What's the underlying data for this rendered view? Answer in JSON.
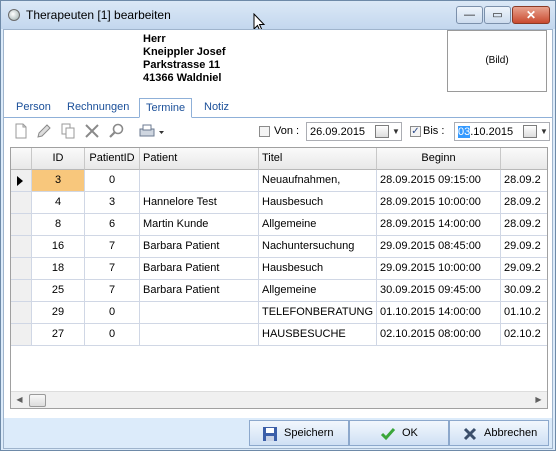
{
  "window": {
    "title": "Therapeuten [1] bearbeiten",
    "minimize_glyph": "—",
    "maximize_glyph": "▭",
    "close_glyph": "✕"
  },
  "address": {
    "salutation": "Herr",
    "name": "Kneippler Josef",
    "street": "Parkstrasse 11",
    "city": "41366 Waldniel"
  },
  "picture": {
    "label": "(Bild)"
  },
  "tabs": [
    {
      "label": "Person"
    },
    {
      "label": "Rechnungen"
    },
    {
      "label": "Termine",
      "active": true
    },
    {
      "label": "Notiz"
    }
  ],
  "toolbar": {
    "icons": [
      "new-document-icon",
      "edit-pencil-icon",
      "copy-icon",
      "delete-x-icon",
      "search-magnifier-icon",
      "print-icon"
    ],
    "from_label": "Von :",
    "from_checked": false,
    "from_date": "26.09.2015",
    "to_label": "Bis :",
    "to_checked": true,
    "to_date_selected": "03",
    "to_date_rest": ".10.2015"
  },
  "grid": {
    "columns": [
      "",
      "ID",
      "PatientID",
      "Patient",
      "Titel",
      "Beginn",
      ""
    ],
    "rows": [
      {
        "id": "3",
        "patient_id": "0",
        "patient": "",
        "titel": "Neuaufnahmen,",
        "beginn": "28.09.2015 09:15:00",
        "ende": "28.09.2"
      },
      {
        "id": "4",
        "patient_id": "3",
        "patient": "Hannelore Test",
        "titel": "Hausbesuch",
        "beginn": "28.09.2015 10:00:00",
        "ende": "28.09.2"
      },
      {
        "id": "8",
        "patient_id": "6",
        "patient": "Martin Kunde",
        "titel": "Allgemeine",
        "beginn": "28.09.2015 14:00:00",
        "ende": "28.09.2"
      },
      {
        "id": "16",
        "patient_id": "7",
        "patient": "Barbara Patient",
        "titel": "Nachuntersuchung",
        "beginn": "29.09.2015 08:45:00",
        "ende": "29.09.2"
      },
      {
        "id": "18",
        "patient_id": "7",
        "patient": "Barbara Patient",
        "titel": "Hausbesuch",
        "beginn": "29.09.2015 10:00:00",
        "ende": "29.09.2"
      },
      {
        "id": "25",
        "patient_id": "7",
        "patient": "Barbara Patient",
        "titel": "Allgemeine",
        "beginn": "30.09.2015 09:45:00",
        "ende": "30.09.2"
      },
      {
        "id": "29",
        "patient_id": "0",
        "patient": "",
        "titel": "TELEFONBERATUNG",
        "beginn": "01.10.2015 14:00:00",
        "ende": "01.10.2"
      },
      {
        "id": "27",
        "patient_id": "0",
        "patient": "",
        "titel": "HAUSBESUCHE",
        "beginn": "02.10.2015 08:00:00",
        "ende": "02.10.2"
      }
    ]
  },
  "buttons": {
    "save_label": "Speichern",
    "ok_label": "OK",
    "cancel_label": "Abbrechen"
  },
  "colors": {
    "current_cell": "#f8c77c",
    "tab_text": "#1a4f99",
    "frame": "#dcebfa"
  }
}
